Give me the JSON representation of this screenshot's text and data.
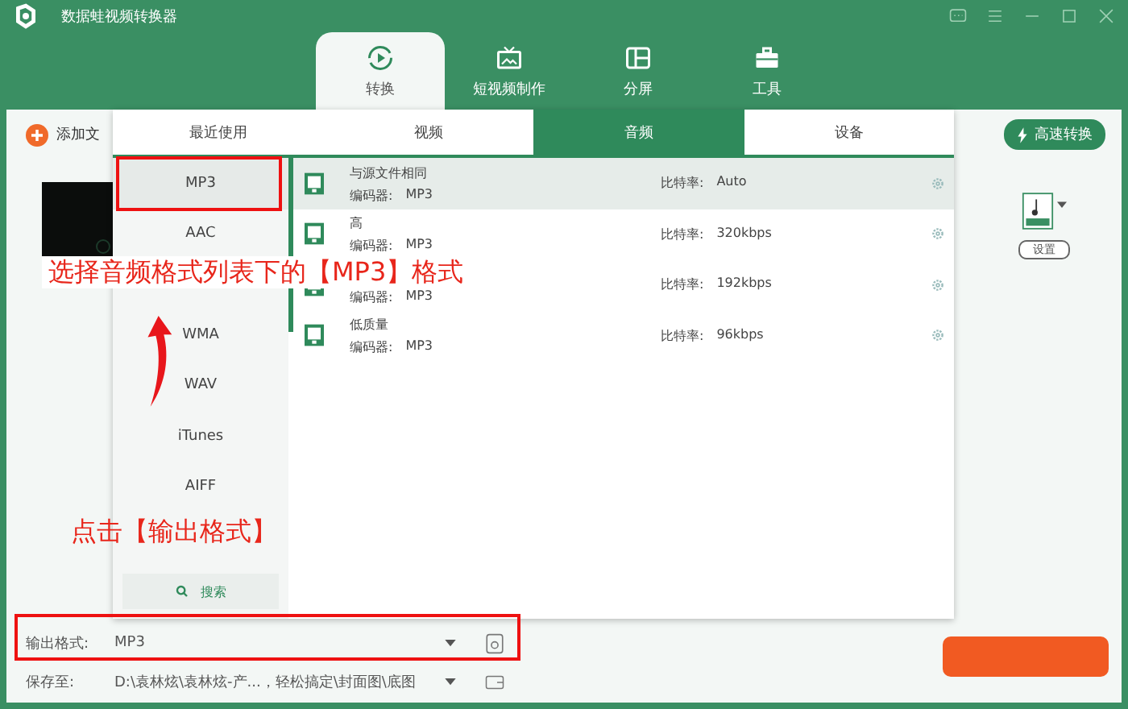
{
  "window": {
    "title": "数据蛙视频转换器"
  },
  "nav_tabs": [
    {
      "label": "转换",
      "selected": true
    },
    {
      "label": "短视频制作",
      "selected": false
    },
    {
      "label": "分屏",
      "selected": false
    },
    {
      "label": "工具",
      "selected": false
    }
  ],
  "add_file": {
    "label": "添加文"
  },
  "fast_convert": {
    "label": "高速转换"
  },
  "file_settings": {
    "label": "设置"
  },
  "format_panel": {
    "tabs": [
      {
        "label": "最近使用",
        "selected": false
      },
      {
        "label": "视频",
        "selected": false
      },
      {
        "label": "音频",
        "selected": true
      },
      {
        "label": "设备",
        "selected": false
      }
    ],
    "formats": [
      {
        "label": "MP3",
        "selected": true
      },
      {
        "label": "AAC",
        "selected": false
      },
      {
        "label": "WMA",
        "selected": false
      },
      {
        "label": "WAV",
        "selected": false
      },
      {
        "label": "iTunes",
        "selected": false
      },
      {
        "label": "AIFF",
        "selected": false
      }
    ],
    "search": {
      "label": "搜索"
    },
    "presets": [
      {
        "name": "与源文件相同",
        "encoder_label": "编码器:",
        "encoder": "MP3",
        "bitrate_label": "比特率:",
        "bitrate": "Auto",
        "selected": true
      },
      {
        "name": "高",
        "encoder_label": "编码器:",
        "encoder": "MP3",
        "bitrate_label": "比特率:",
        "bitrate": "320kbps",
        "selected": false
      },
      {
        "encoder_label": "编码器:",
        "encoder": "MP3",
        "bitrate_label": "比特率:",
        "bitrate": "192kbps",
        "selected": false
      },
      {
        "name": "低质量",
        "encoder_label": "编码器:",
        "encoder": "MP3",
        "bitrate_label": "比特率:",
        "bitrate": "96kbps",
        "selected": false
      }
    ]
  },
  "output": {
    "format_label": "输出格式:",
    "format": "MP3",
    "save_label": "保存至:",
    "save_path": "D:\\袁林炫\\袁林炫-产...，轻松搞定\\封面图\\底图"
  },
  "annotations": {
    "top": "选择音频格式列表下的【MP3】格式",
    "bottom": "点击【输出格式】"
  }
}
